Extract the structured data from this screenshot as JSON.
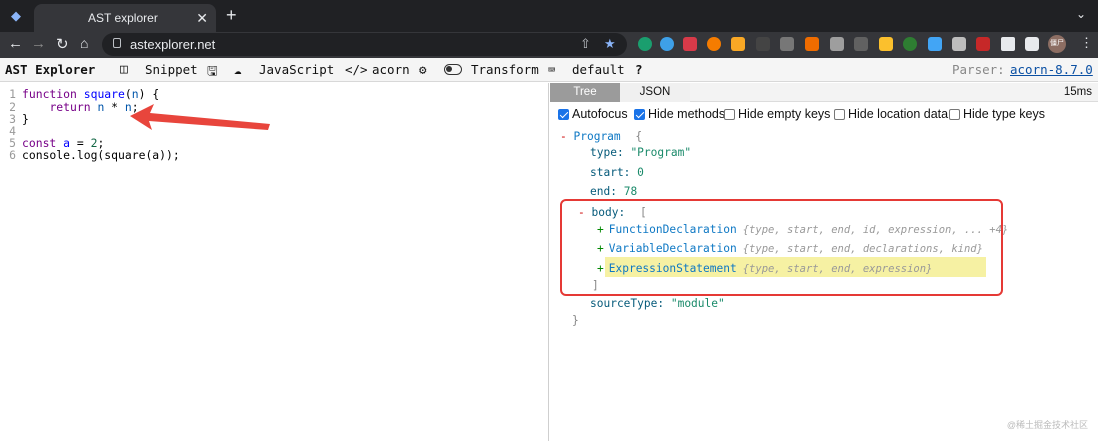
{
  "browser": {
    "tab_title": "AST explorer",
    "url": "astexplorer.net",
    "profile_badge": "僵尸"
  },
  "appbar": {
    "brand": "AST Explorer",
    "snippet_label": "Snippet",
    "language_label": "JavaScript",
    "parser_label": "acorn",
    "transform_label": "Transform",
    "keymap_label": "default",
    "help_label": "?",
    "parser_prefix": "Parser:",
    "parser_version": "acorn-8.7.0"
  },
  "editor": {
    "lines": [
      {
        "n": "1",
        "tokens": [
          {
            "t": "function",
            "c": "kw"
          },
          {
            "t": " ",
            "c": "plain"
          },
          {
            "t": "square",
            "c": "fn"
          },
          {
            "t": "(",
            "c": "plain"
          },
          {
            "t": "n",
            "c": "vr"
          },
          {
            "t": ") {",
            "c": "plain"
          }
        ]
      },
      {
        "n": "2",
        "tokens": [
          {
            "t": "    ",
            "c": "plain"
          },
          {
            "t": "return",
            "c": "kw"
          },
          {
            "t": " ",
            "c": "plain"
          },
          {
            "t": "n",
            "c": "vr"
          },
          {
            "t": " * ",
            "c": "plain"
          },
          {
            "t": "n",
            "c": "vr"
          },
          {
            "t": ";",
            "c": "plain"
          }
        ]
      },
      {
        "n": "3",
        "tokens": [
          {
            "t": "}",
            "c": "plain"
          }
        ]
      },
      {
        "n": "4",
        "tokens": []
      },
      {
        "n": "5",
        "tokens": [
          {
            "t": "const",
            "c": "kw"
          },
          {
            "t": " ",
            "c": "plain"
          },
          {
            "t": "a",
            "c": "fn"
          },
          {
            "t": " = ",
            "c": "plain"
          },
          {
            "t": "2",
            "c": "num"
          },
          {
            "t": ";",
            "c": "plain"
          }
        ]
      },
      {
        "n": "6",
        "tokens": [
          {
            "t": "console.log(square(a));",
            "c": "plain"
          }
        ]
      }
    ]
  },
  "panel": {
    "tab_tree": "Tree",
    "tab_json": "JSON",
    "parse_time": "15ms",
    "options": [
      {
        "label": "Autofocus",
        "checked": true
      },
      {
        "label": "Hide methods",
        "checked": true
      },
      {
        "label": "Hide empty keys",
        "checked": false
      },
      {
        "label": "Hide location data",
        "checked": false
      },
      {
        "label": "Hide type keys",
        "checked": false
      }
    ]
  },
  "tree": {
    "root_toggle": "-",
    "root_name": "Program",
    "root_open": "{",
    "type_key": "type:",
    "type_val": "\"Program\"",
    "start_key": "start:",
    "start_val": "0",
    "end_key": "end:",
    "end_val": "78",
    "body_toggle": "-",
    "body_key": "body:",
    "body_open": "[",
    "body_items": [
      {
        "toggle": "+",
        "name": "FunctionDeclaration",
        "summary": "{type, start, end, id, expression, ... +4}",
        "highlighted": false
      },
      {
        "toggle": "+",
        "name": "VariableDeclaration",
        "summary": "{type, start, end, declarations, kind}",
        "highlighted": false
      },
      {
        "toggle": "+",
        "name": "ExpressionStatement",
        "summary": "{type, start, end, expression}",
        "highlighted": true
      }
    ],
    "body_close": "]",
    "sourcetype_key": "sourceType:",
    "sourcetype_val": "\"module\"",
    "root_close": "}"
  },
  "watermark": "@稀土掘金技术社区"
}
